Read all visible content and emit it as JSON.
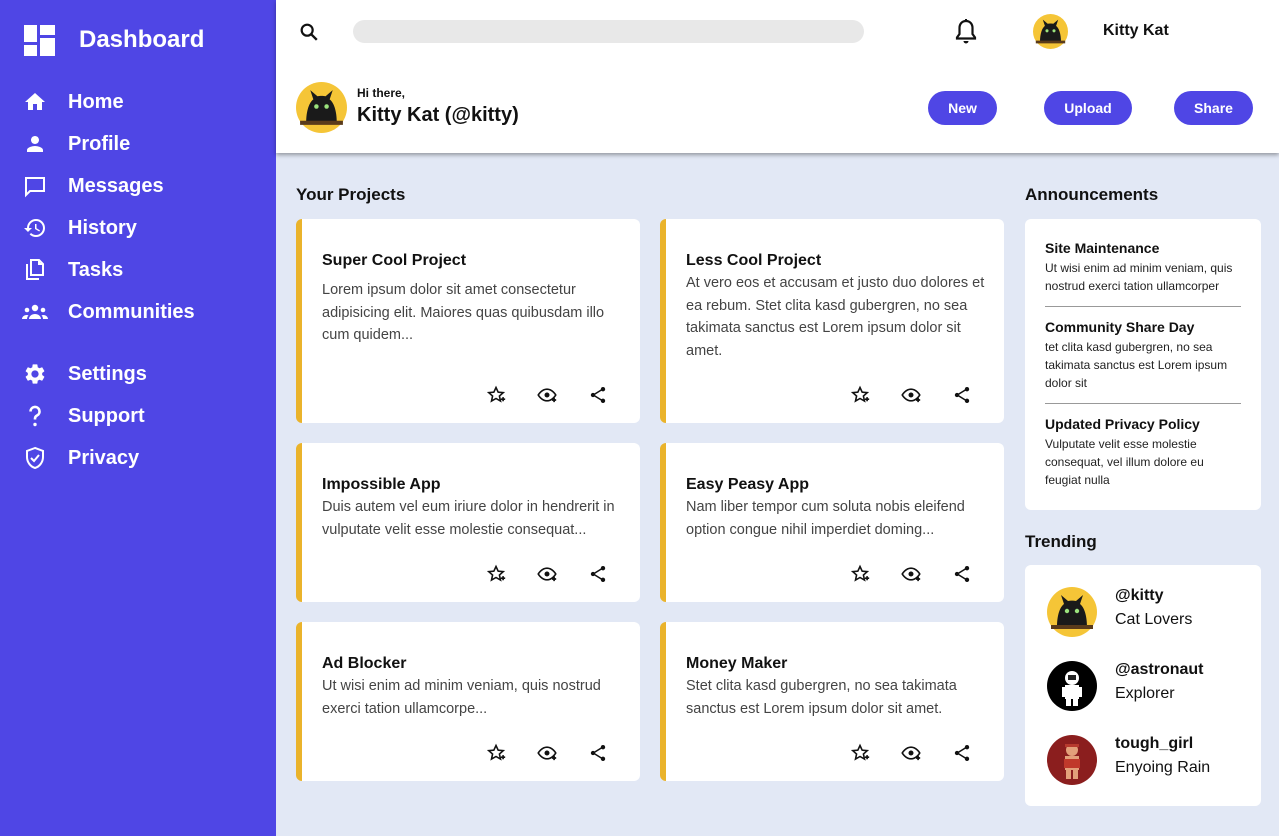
{
  "app": {
    "title": "Dashboard"
  },
  "sidebar": {
    "items": [
      {
        "label": "Home",
        "icon": "home-icon"
      },
      {
        "label": "Profile",
        "icon": "person-icon"
      },
      {
        "label": "Messages",
        "icon": "message-icon"
      },
      {
        "label": "History",
        "icon": "history-icon"
      },
      {
        "label": "Tasks",
        "icon": "tasks-icon"
      },
      {
        "label": "Communities",
        "icon": "groups-icon"
      }
    ],
    "secondary": [
      {
        "label": "Settings",
        "icon": "gear-icon"
      },
      {
        "label": "Support",
        "icon": "question-icon"
      },
      {
        "label": "Privacy",
        "icon": "shield-icon"
      }
    ]
  },
  "header": {
    "search": {
      "value": "",
      "placeholder": ""
    },
    "user_name": "Kitty Kat",
    "greeting": "Hi there,",
    "display_name": "Kitty Kat (@kitty)",
    "buttons": {
      "new": "New",
      "upload": "Upload",
      "share": "Share"
    }
  },
  "projects": {
    "title": "Your Projects",
    "items": [
      {
        "title": "Super Cool Project",
        "desc": "Lorem ipsum dolor sit amet consectetur adipisicing elit. Maiores quas quibusdam illo cum quidem..."
      },
      {
        "title": "Less Cool Project",
        "desc": "At vero eos et accusam et justo duo dolores et ea rebum. Stet clita kasd gubergren, no sea takimata sanctus est Lorem ipsum dolor sit amet."
      },
      {
        "title": "Impossible App",
        "desc": "Duis autem vel eum iriure dolor in hendrerit in vulputate velit esse molestie consequat..."
      },
      {
        "title": "Easy Peasy App",
        "desc": "Nam liber tempor cum soluta nobis eleifend option congue nihil imperdiet doming..."
      },
      {
        "title": "Ad Blocker",
        "desc": "Ut wisi enim ad minim veniam, quis nostrud exerci tation ullamcorpe..."
      },
      {
        "title": "Money Maker",
        "desc": "Stet clita kasd gubergren, no sea takimata sanctus est Lorem ipsum dolor sit amet."
      }
    ]
  },
  "announcements": {
    "title": "Announcements",
    "items": [
      {
        "title": "Site Maintenance",
        "text": "Ut wisi enim ad minim veniam, quis nostrud exerci tation ullamcorper"
      },
      {
        "title": "Community Share Day",
        "text": "tet clita kasd gubergren, no sea takimata sanctus est Lorem ipsum dolor sit"
      },
      {
        "title": "Updated Privacy Policy",
        "text": "Vulputate velit esse molestie consequat, vel illum dolore eu feugiat nulla"
      }
    ]
  },
  "trending": {
    "title": "Trending",
    "items": [
      {
        "handle": "@kitty",
        "sub": "Cat Lovers"
      },
      {
        "handle": "@astronaut",
        "sub": "Explorer"
      },
      {
        "handle": "tough_girl",
        "sub": "Enyoing Rain"
      }
    ]
  },
  "colors": {
    "accent": "#4f46e5",
    "card_stripe": "#eab32b",
    "background": "#e2e8f5"
  }
}
